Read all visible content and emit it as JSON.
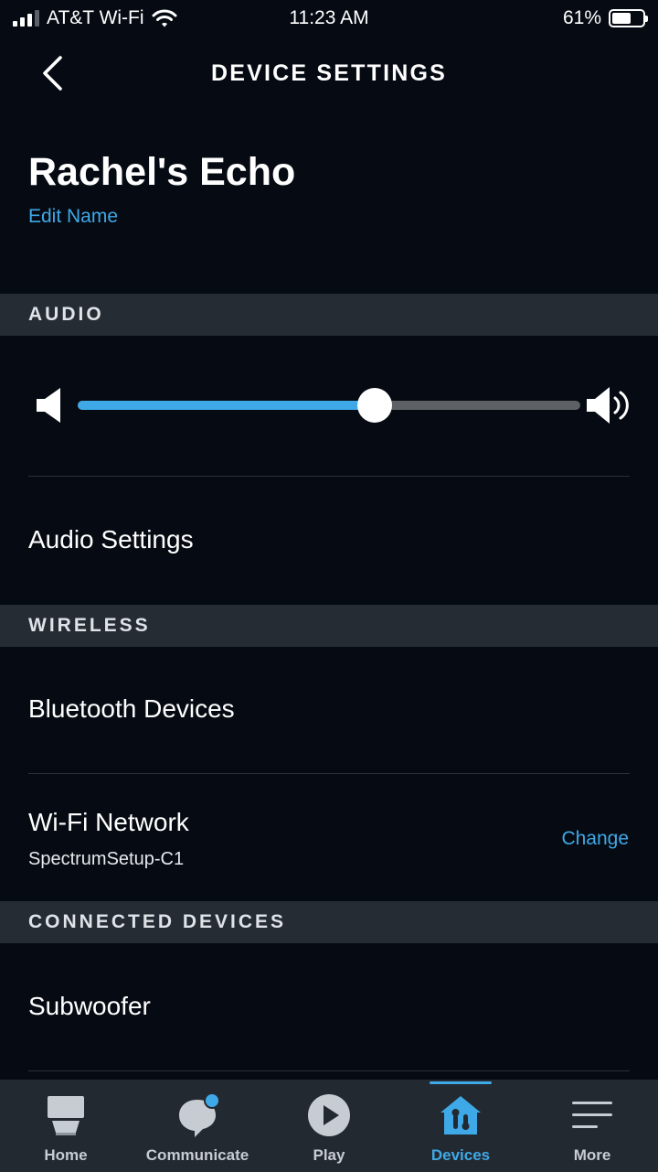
{
  "status_bar": {
    "carrier": "AT&T Wi-Fi",
    "time": "11:23 AM",
    "battery_percent": "61%",
    "battery_level": 0.61
  },
  "header": {
    "title": "DEVICE SETTINGS",
    "back_icon": "chevron-left-icon"
  },
  "device": {
    "name": "Rachel's Echo",
    "edit_label": "Edit Name"
  },
  "sections": {
    "audio": "AUDIO",
    "wireless": "WIRELESS",
    "connected": "CONNECTED DEVICES"
  },
  "volume": {
    "level": 0.59,
    "min_icon": "speaker-low-icon",
    "max_icon": "speaker-high-icon"
  },
  "rows": {
    "audio_settings": "Audio Settings",
    "bluetooth": "Bluetooth Devices",
    "wifi_label": "Wi-Fi Network",
    "wifi_value": "SpectrumSetup-C1",
    "wifi_action": "Change",
    "subwoofer": "Subwoofer"
  },
  "tabs": [
    {
      "label": "Home",
      "icon": "home-icon",
      "active": false
    },
    {
      "label": "Communicate",
      "icon": "chat-bubble-icon",
      "active": false
    },
    {
      "label": "Play",
      "icon": "play-icon",
      "active": false
    },
    {
      "label": "Devices",
      "icon": "devices-icon",
      "active": true
    },
    {
      "label": "More",
      "icon": "menu-icon",
      "active": false
    }
  ],
  "colors": {
    "background": "#060b13",
    "accent": "#3fa8e6",
    "section_bg": "#262c33",
    "tabbar_bg": "#232931"
  }
}
